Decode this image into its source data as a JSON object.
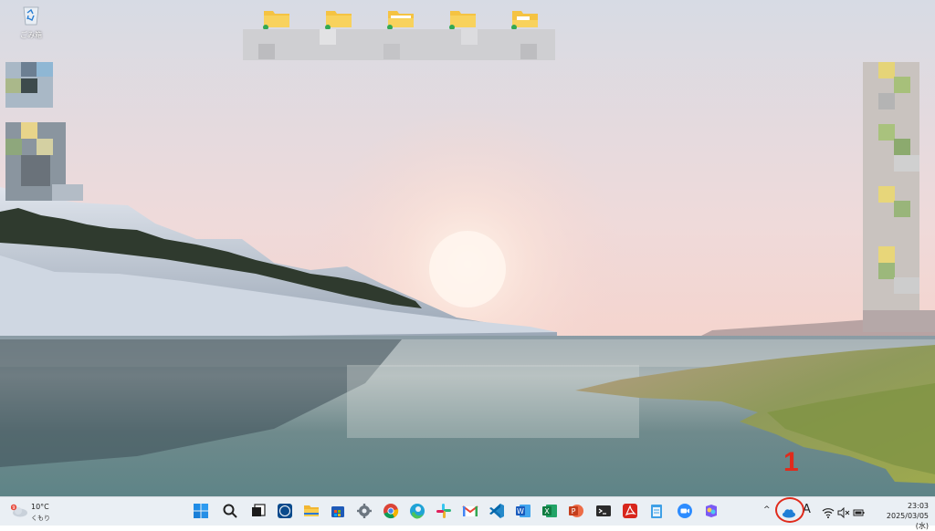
{
  "desktop": {
    "recycle_bin_label": "ごみ箱"
  },
  "taskbar": {
    "weather": {
      "temperature": "10°C",
      "condition": "くもり",
      "badge": "9"
    },
    "apps": [
      "start-icon",
      "search-icon",
      "task-view-icon",
      "dell-icon",
      "file-explorer-icon",
      "store-icon",
      "settings-icon",
      "chrome-icon",
      "edge-icon",
      "slack-icon",
      "gmail-icon",
      "vscode-icon",
      "word-icon",
      "excel-icon",
      "powerpoint-icon",
      "terminal-icon",
      "acrobat-icon",
      "notepad-icon",
      "zoom-icon",
      "copilot-icon"
    ],
    "tray": {
      "chevron": "^",
      "ime": "A",
      "time": "23:03",
      "date": "2025/03/05 (水)"
    }
  },
  "annotation": {
    "number": "1",
    "color": "#e02b1c"
  }
}
